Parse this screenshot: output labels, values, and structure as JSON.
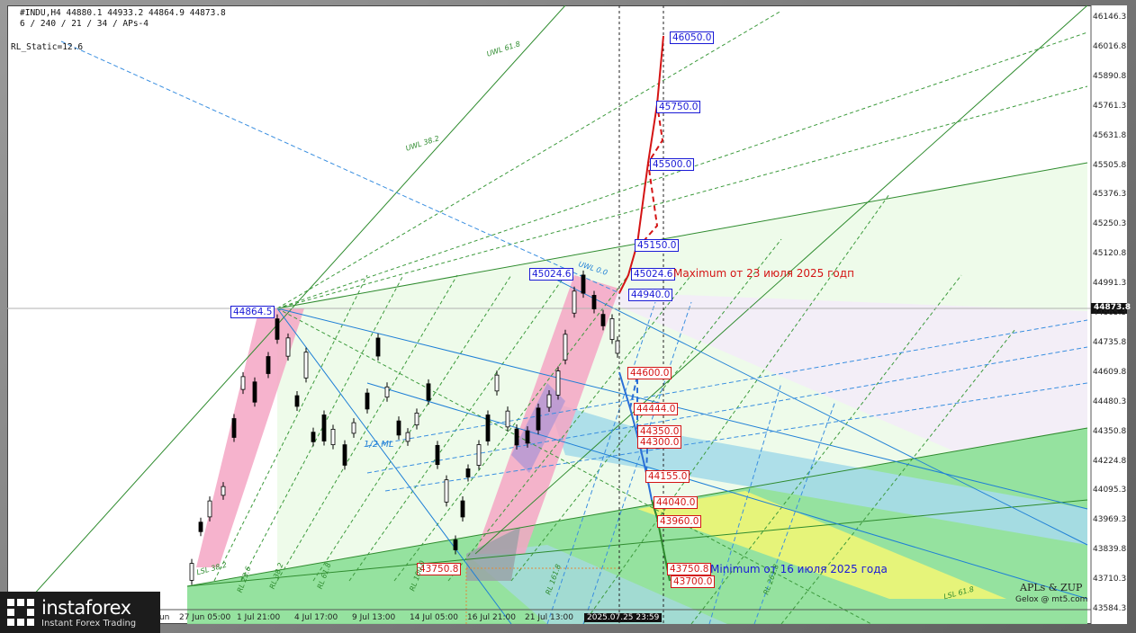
{
  "header": {
    "symbol_line": "#INDU,H4  44880.1 44933.2 44864.9 44873.8",
    "params_line": "6 / 240 / 21 / 34 / APs-4",
    "static_line": "RL_Static=12.6"
  },
  "price_axis": {
    "ticks": [
      "46146.3",
      "46016.8",
      "45890.8",
      "45761.3",
      "45631.8",
      "45505.8",
      "45376.3",
      "45250.3",
      "45120.8",
      "44991.3",
      "44865.3",
      "44735.8",
      "44609.8",
      "44480.3",
      "44350.8",
      "44224.8",
      "44095.3",
      "43969.3",
      "43839.8",
      "43710.3",
      "43584.3"
    ],
    "current_price": "44873.8"
  },
  "time_axis": {
    "labels": [
      "30 Jun",
      "27 Jun 05:00",
      "1 Jul 21:00",
      "4 Jul 17:00",
      "9 Jul 13:00",
      "14 Jul 05:00",
      "16 Jul 21:00",
      "21 Jul 13:00",
      "2025.07.25 23:59"
    ]
  },
  "price_tags": {
    "t46050": "46050.0",
    "t45750": "45750.0",
    "t45500": "45500.0",
    "t45150": "45150.0",
    "t45024b": "45024.6",
    "t44940": "44940.0",
    "t45024a": "45024.6",
    "t44864": "44864.5",
    "t44600": "44600.0",
    "t44444": "44444.0",
    "t44350": "44350.0",
    "t44300": "44300.0",
    "t44155": "44155.0",
    "t44040": "44040.0",
    "t43960": "43960.0",
    "t43750a": "43750.8",
    "t43750b": "43750.8",
    "t43700": "43700.0"
  },
  "annotations": {
    "max_note": "Maximum от 23 июля 2025 годп",
    "min_note": "Minimum от 16 июля 2025 года",
    "ml_label": "1/2 ML",
    "uwl_618": "UWL 61.8",
    "uwl_382": "UWL 38.2",
    "uwl_top": "UWL 0.0",
    "rl_382": "RL 38.2",
    "rl_618": "RL 61.8",
    "rl_100": "RL 100.0",
    "rl_1618": "RL 161.8",
    "rl_2618": "RL 261.8",
    "rl_236": "RL 23.6",
    "lsl_618": "LSL 61.8",
    "lsl_382": "LSL 38.2",
    "credit_1": "APLs & ZUP",
    "credit_2": "Gelox @ mt5.com"
  },
  "logo": {
    "name": "instaforex",
    "tagline": "Instant Forex Trading"
  },
  "colors": {
    "up_target": "#d41414",
    "down_target": "#1a1ad6",
    "fan_green": "#2e8b2e",
    "fan_blue": "#1e7fd6",
    "zone_pink": "#f4a6c4",
    "zone_green": "#8ee08e",
    "zone_yellow": "#e8f57a",
    "zone_cyan": "#9fd9ea"
  },
  "chart_data": {
    "type": "candlestick",
    "symbol": "#INDU",
    "timeframe": "H4",
    "ohlc_last": {
      "open": 44880.1,
      "high": 44933.2,
      "low": 44864.9,
      "close": 44873.8
    },
    "ylim": [
      43584.3,
      46146.3
    ],
    "upside_targets": [
      44940.0,
      45024.6,
      45150.0,
      45500.0,
      45750.0,
      46050.0
    ],
    "downside_targets": [
      44600.0,
      44444.0,
      44350.0,
      44300.0,
      44155.0,
      44040.0,
      43960.0,
      43750.8,
      43700.0
    ],
    "pivots": {
      "high_1": 44864.5,
      "high_2": 45024.6,
      "low_1": 43750.8
    }
  }
}
